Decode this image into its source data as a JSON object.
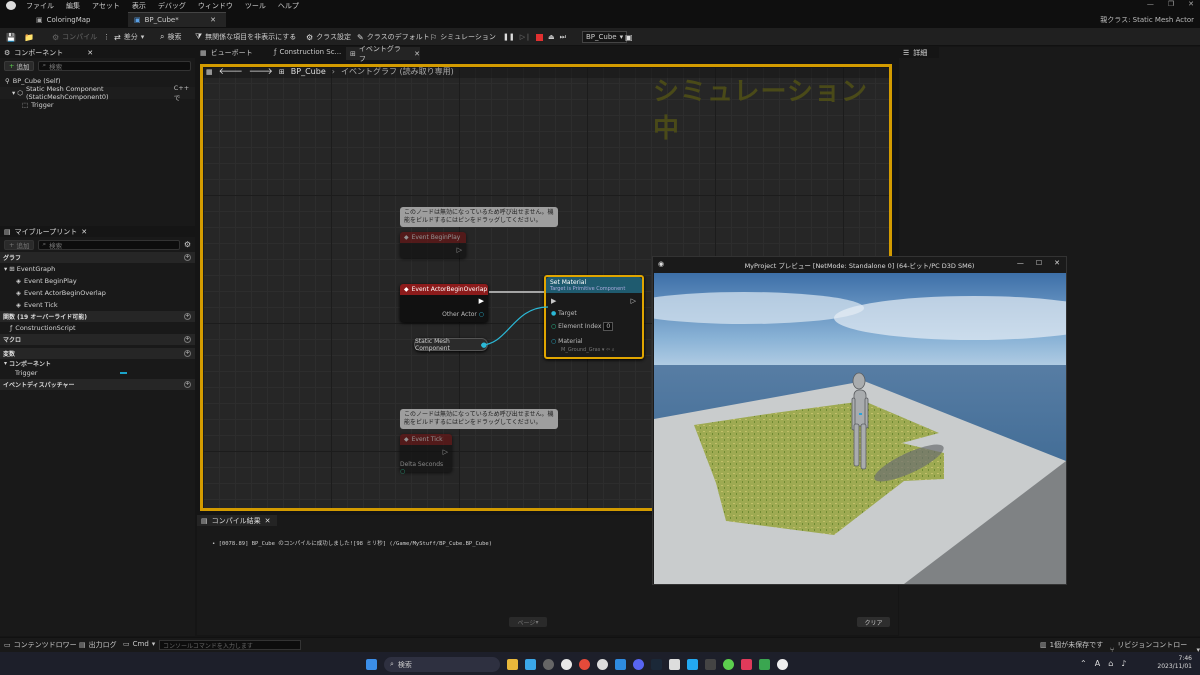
{
  "menu": [
    "ファイル",
    "編集",
    "アセット",
    "表示",
    "デバッグ",
    "ウィンドウ",
    "ツール",
    "ヘルプ"
  ],
  "tabs": {
    "coloring_map": "ColoringMap",
    "bp_cube": "BP_Cube*"
  },
  "parent_class_label": "親クラス: Static Mesh Actor",
  "toolbar": {
    "compile": "コンパイル",
    "diff": "差分",
    "find": "検索",
    "hide_unrelated": "無関係な項目を非表示にする",
    "class_settings": "クラス設定",
    "class_defaults": "クラスのデフォルト",
    "simulation": "シミュレーション",
    "debug_object": "BP_Cube"
  },
  "components_panel": {
    "title": "コンポーネント",
    "add": "追加",
    "search_placeholder": "検索",
    "root": "BP_Cube (Self)",
    "mesh": "Static Mesh Component (StaticMeshComponent0)",
    "cpp": "C++ で",
    "trigger": "Trigger"
  },
  "my_blueprint": {
    "title": "マイブループリント",
    "add": "追加",
    "search_placeholder": "検索",
    "graphs_header": "グラフ",
    "event_graph": "EventGraph",
    "events": [
      "Event BeginPlay",
      "Event ActorBeginOverlap",
      "Event Tick"
    ],
    "functions_header": "関数 (19 オーバーライド可能)",
    "construction": "ConstructionScript",
    "macros_header": "マクロ",
    "variables_header": "変数",
    "components_sub": "コンポーネント",
    "var_trigger": "Trigger",
    "dispatchers_header": "イベントディスパッチャー"
  },
  "graph_tabs": {
    "viewport": "ビューポート",
    "construction": "Construction Sc...",
    "event_graph": "イベントグラフ"
  },
  "breadcrumb": {
    "bp": "BP_Cube",
    "graph": "イベントグラフ (読み取り専用)"
  },
  "sim_watermark": "シミュレーション中",
  "comment_text": "このノードは無効になっているため呼び出せません。機能をビルドするにはピンをドラッグしてください。",
  "nodes": {
    "begin_play": "Event BeginPlay",
    "overlap": "Event ActorBeginOverlap",
    "other_actor": "Other Actor",
    "set_material": "Set Material",
    "set_material_sub": "Target is Primitive Component",
    "target": "Target",
    "element_index": "Element Index",
    "element_index_value": "0",
    "material": "Material",
    "material_value": "M_Ground_Gras",
    "static_mesh": "Static Mesh Component",
    "tick": "Event Tick",
    "delta": "Delta Seconds"
  },
  "details": {
    "title": "詳細"
  },
  "preview": {
    "title": "MyProject プレビュー [NetMode: Standalone 0] (64-ビット/PC D3D SM6)"
  },
  "compiler": {
    "title": "コンパイル結果",
    "log": "• [0078.89] BP_Cube のコンパイルに成功しました![98 ミリ秒] (/Game/MyStuff/BP_Cube.BP_Cube)",
    "page": "ページ",
    "clear": "クリア"
  },
  "bottom": {
    "content_drawer": "コンテンツドロワー",
    "output_log": "出力ログ",
    "cmd": "Cmd",
    "console_placeholder": "コンソールコマンドを入力します",
    "unsaved": "1個が未保存です",
    "source_control": "リビジョンコントロール"
  },
  "taskbar": {
    "search": "検索",
    "time": "7:46",
    "date": "2023/11/01"
  }
}
